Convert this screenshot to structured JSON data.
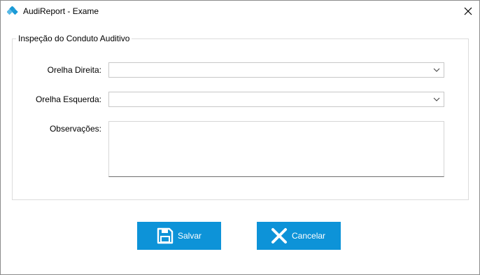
{
  "window": {
    "title": "AudiReport - Exame",
    "app_icon": "audireport-logo-icon",
    "close_icon": "close-icon"
  },
  "group": {
    "legend": "Inspeção do Conduto Auditivo"
  },
  "fields": {
    "orelha_direita": {
      "label": "Orelha Direita:",
      "value": ""
    },
    "orelha_esquerda": {
      "label": "Orelha Esquerda:",
      "value": ""
    },
    "observacoes": {
      "label": "Observações:",
      "value": ""
    }
  },
  "buttons": {
    "save": {
      "label": "Salvar",
      "icon": "floppy-disk-icon"
    },
    "cancel": {
      "label": "Cancelar",
      "icon": "x-icon"
    }
  },
  "colors": {
    "button_bg": "#0d93d8",
    "app_icon_primary": "#1a9ad6"
  }
}
